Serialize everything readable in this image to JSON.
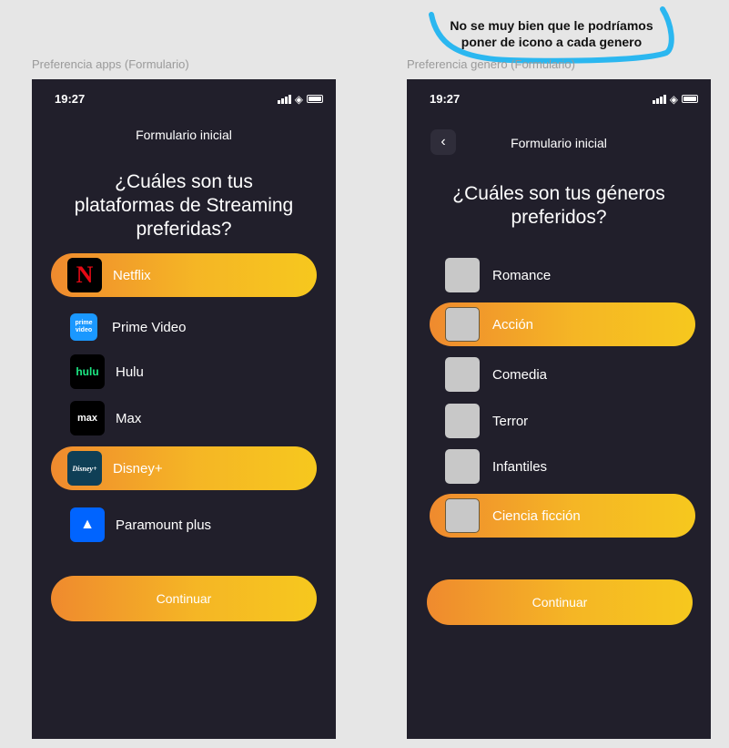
{
  "note": {
    "lines": [
      "No se muy bien que le podríamos",
      "poner de icono a cada genero"
    ]
  },
  "left": {
    "frame_label": "Preferencia apps (Formulario)",
    "time": "19:27",
    "title": "Formulario inicial",
    "question_lines": [
      "¿Cuáles son tus",
      "plataformas de Streaming",
      "preferidas?"
    ],
    "platforms": [
      {
        "label": "Netflix",
        "selected": true,
        "icon": "netflix-icon",
        "icon_text": "N",
        "icon_bg": "#000000",
        "icon_color": "#e50914"
      },
      {
        "label": "Prime Video",
        "selected": false,
        "icon": "prime-video-icon",
        "icon_text": "prime video",
        "icon_bg": "#1a98ff",
        "icon_color": "#ffffff"
      },
      {
        "label": "Hulu",
        "selected": false,
        "icon": "hulu-icon",
        "icon_text": "hulu",
        "icon_bg": "#000000",
        "icon_color": "#1ce783"
      },
      {
        "label": "Max",
        "selected": false,
        "icon": "max-icon",
        "icon_text": "max",
        "icon_bg": "#000000",
        "icon_color": "#ffffff"
      },
      {
        "label": "Disney+",
        "selected": true,
        "icon": "disney-plus-icon",
        "icon_text": "Disney+",
        "icon_bg": "#0f3f56",
        "icon_color": "#ffffff"
      },
      {
        "label": "Paramount plus",
        "selected": false,
        "icon": "paramount-plus-icon",
        "icon_text": "▲",
        "icon_bg": "#0064ff",
        "icon_color": "#ffffff"
      }
    ],
    "continue_label": "Continuar"
  },
  "right": {
    "frame_label": "Preferencia genero (Formulario)",
    "time": "19:27",
    "title": "Formulario inicial",
    "question_lines": [
      "¿Cuáles son tus géneros",
      "preferidos?"
    ],
    "genres": [
      {
        "label": "Romance",
        "selected": false
      },
      {
        "label": "Acción",
        "selected": true
      },
      {
        "label": "Comedia",
        "selected": false
      },
      {
        "label": "Terror",
        "selected": false
      },
      {
        "label": "Infantiles",
        "selected": false
      },
      {
        "label": "Ciencia ficción",
        "selected": true
      }
    ],
    "continue_label": "Continuar"
  },
  "colors": {
    "phone_bg": "#211f2b",
    "accent_start": "#ef8a2e",
    "accent_end": "#f6c81e",
    "checkbox": "#c8c8c8",
    "annotation_stroke": "#2bb7f0"
  }
}
